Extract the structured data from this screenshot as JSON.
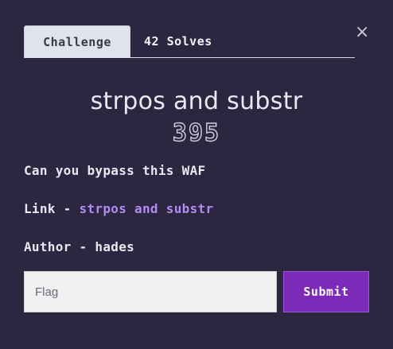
{
  "tabs": {
    "challenge_label": "Challenge",
    "solves_label": "42 Solves"
  },
  "close_glyph": "×",
  "challenge": {
    "title": "strpos and substr",
    "points": "395",
    "description": "Can you bypass this WAF",
    "link_prefix": "Link - ",
    "link_text": "strpos and substr",
    "author": "Author - hades"
  },
  "form": {
    "flag_placeholder": "Flag",
    "flag_value": "",
    "submit_label": "Submit"
  },
  "colors": {
    "background": "#2c2640",
    "accent": "#7b2bb8",
    "link": "#b08cf0"
  },
  "icons": {
    "close": "close-icon"
  }
}
